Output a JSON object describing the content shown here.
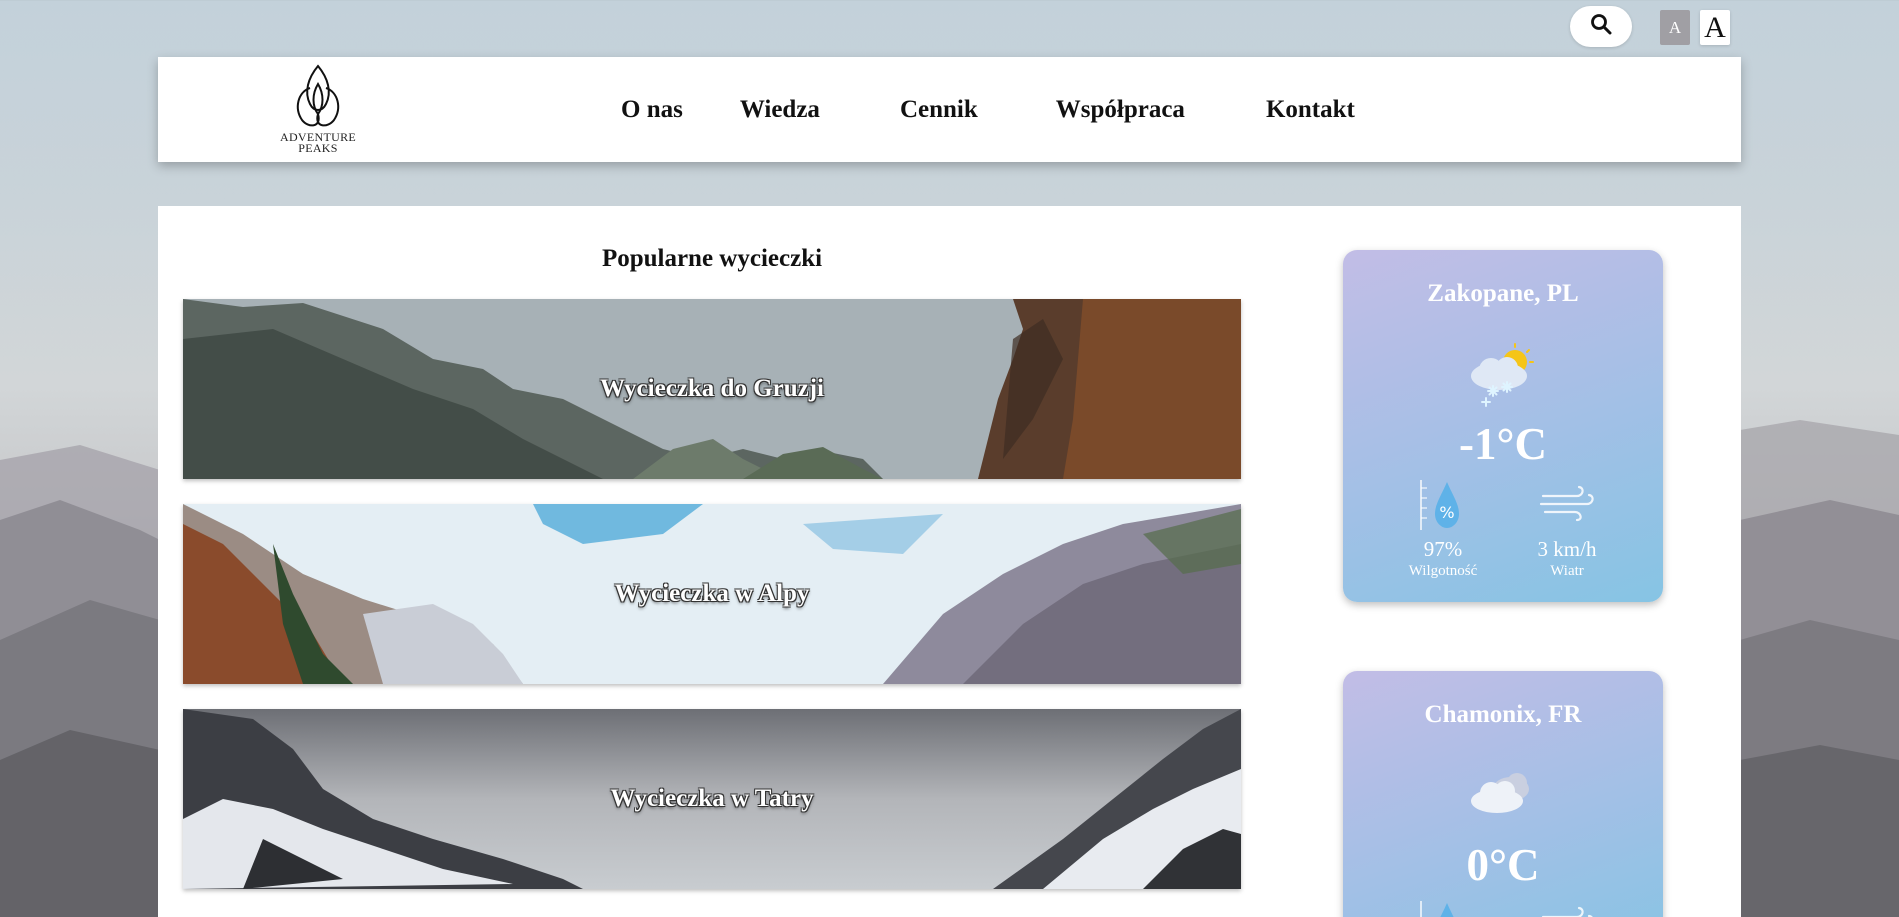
{
  "controls": {
    "font_small_label": "A",
    "font_large_label": "A"
  },
  "header": {
    "logo_line1": "ADVENTURE",
    "logo_line2": "PEAKS",
    "nav": [
      "O nas",
      "Wiedza",
      "Cennik",
      "Współpraca",
      "Kontakt"
    ]
  },
  "main": {
    "title": "Popularne wycieczki",
    "trips": [
      {
        "label": "Wycieczka do Gruzji"
      },
      {
        "label": "Wycieczka w Alpy"
      },
      {
        "label": "Wycieczka w Tatry"
      }
    ]
  },
  "weather": [
    {
      "city": "Zakopane, PL",
      "icon": "snow-partly-sunny-icon",
      "temp": "-1°C",
      "humidity": "97%",
      "humidity_label": "Wilgotność",
      "wind": "3 km/h",
      "wind_label": "Wiatr"
    },
    {
      "city": "Chamonix, FR",
      "icon": "cloudy-icon",
      "temp": "0°C"
    }
  ],
  "colors": {
    "weather_card_top": "#c2bde6",
    "weather_card_bottom": "#86c4e4",
    "sun": "#f5c518"
  }
}
